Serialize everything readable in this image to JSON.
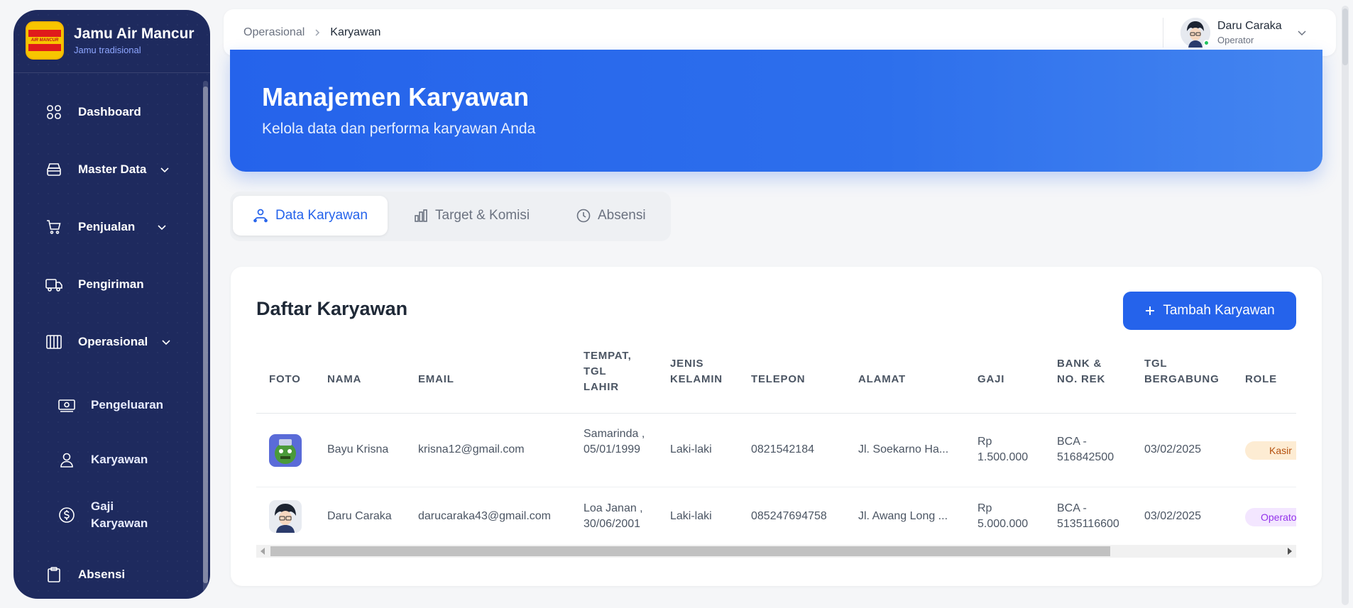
{
  "sidebar": {
    "brand_title": "Jamu Air Mancur",
    "brand_subtitle": "Jamu tradisional",
    "logo_text": "AIR MANCUR",
    "items": [
      {
        "label": "Dashboard",
        "icon": "grid-icon"
      },
      {
        "label": "Master Data",
        "icon": "database-icon"
      },
      {
        "label": "Penjualan",
        "icon": "cart-icon"
      },
      {
        "label": "Pengiriman",
        "icon": "truck-icon"
      },
      {
        "label": "Operasional",
        "icon": "columns-icon"
      },
      {
        "label": "Pengeluaran",
        "icon": "money-icon"
      },
      {
        "label": "Karyawan",
        "icon": "user-icon"
      },
      {
        "label": "Gaji Karyawan",
        "icon": "dollar-circle-icon"
      },
      {
        "label": "Absensi",
        "icon": "clipboard-icon"
      }
    ]
  },
  "header": {
    "breadcrumb_parent": "Operasional",
    "breadcrumb_current": "Karyawan",
    "user_name": "Daru Caraka",
    "user_role": "Operator"
  },
  "hero": {
    "title": "Manajemen Karyawan",
    "subtitle": "Kelola data dan performa karyawan Anda"
  },
  "tabs": [
    {
      "label": "Data Karyawan",
      "active": true
    },
    {
      "label": "Target & Komisi",
      "active": false
    },
    {
      "label": "Absensi",
      "active": false
    }
  ],
  "card": {
    "title": "Daftar Karyawan",
    "add_button": "Tambah Karyawan"
  },
  "table": {
    "headers": [
      "FOTO",
      "NAMA",
      "EMAIL",
      "TEMPAT, TGL LAHIR",
      "JENIS KELAMIN",
      "TELEPON",
      "ALAMAT",
      "GAJI",
      "BANK & NO. REK",
      "TGL BERGABUNG",
      "ROLE"
    ],
    "rows": [
      {
        "nama": "Bayu Krisna",
        "email": "krisna12@gmail.com",
        "ttl": "Samarinda , 05/01/1999",
        "jk": "Laki-laki",
        "telepon": "0821542184",
        "alamat": "Jl. Soekarno Ha...",
        "gaji": "Rp 1.500.000",
        "bank": "BCA - 516842500",
        "tgl": "03/02/2025",
        "role": "Kasir"
      },
      {
        "nama": "Daru Caraka",
        "email": "darucaraka43@gmail.com",
        "ttl": "Loa Janan , 30/06/2001",
        "jk": "Laki-laki",
        "telepon": "085247694758",
        "alamat": "Jl. Awang Long ...",
        "gaji": "Rp 5.000.000",
        "bank": "BCA - 5135116600",
        "tgl": "03/02/2025",
        "role": "Operator"
      }
    ]
  },
  "colors": {
    "primary": "#2563eb",
    "sidebar": "#1e2a5e",
    "kasir_badge": "#fdecd3",
    "operator_badge": "#f3e6ff"
  }
}
